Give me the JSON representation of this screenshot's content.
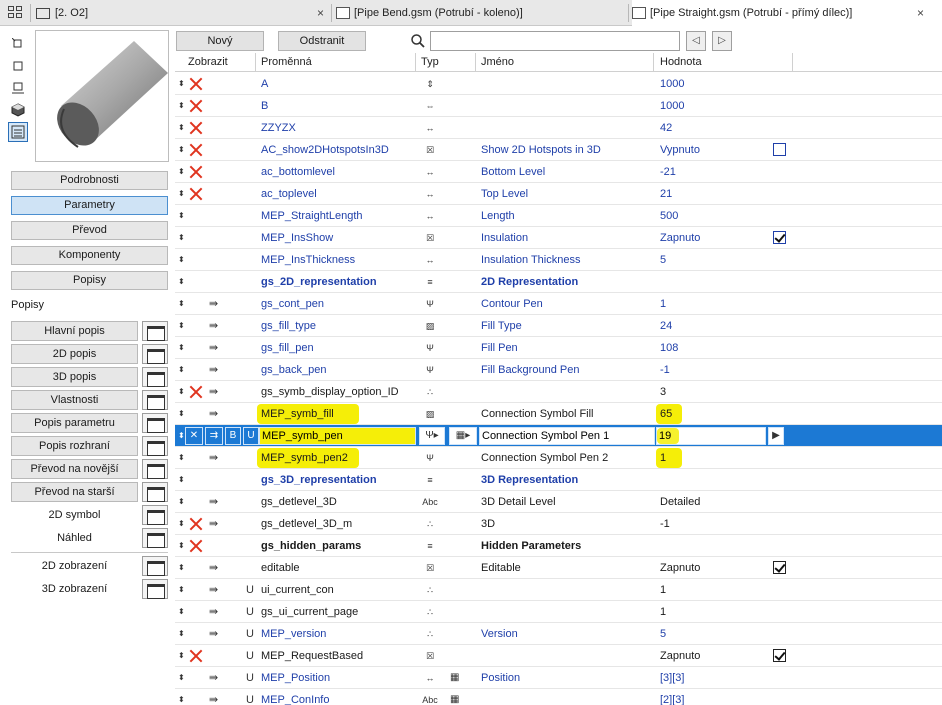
{
  "tabs": [
    {
      "label": "[2. O2]",
      "close": "×"
    },
    {
      "label": "[Pipe Bend.gsm (Potrubí - koleno)]",
      "close": ""
    },
    {
      "label": "[Pipe Straight.gsm (Potrubí - přímý dílec)]",
      "close": "×"
    }
  ],
  "left": {
    "nav_buttons": [
      "Podrobnosti",
      "Parametry",
      "Převod",
      "Komponenty",
      "Popisy"
    ],
    "selected_nav": "Parametry",
    "section_title": "Popisy",
    "popisy_items": [
      "Hlavní popis",
      "2D popis",
      "3D popis",
      "Vlastnosti",
      "Popis parametru",
      "Popis rozhraní",
      "Převod na novější",
      "Převod na starší",
      "2D symbol",
      "Náhled"
    ],
    "view_items": [
      "2D zobrazení",
      "3D zobrazení"
    ]
  },
  "toolbar": {
    "new_label": "Nový",
    "remove_label": "Odstranit",
    "search_value": "",
    "prev": "◁",
    "next": "▷"
  },
  "table": {
    "headers": [
      "Zobrazit",
      "Proměnná",
      "Typ",
      "Jméno",
      "Hodnota"
    ],
    "rows": [
      {
        "var": "A",
        "type_icon": "length-x",
        "name": "",
        "value": "1000",
        "x": true
      },
      {
        "var": "B",
        "type_icon": "length-y",
        "name": "",
        "value": "1000",
        "x": true
      },
      {
        "var": "ZZYZX",
        "type_icon": "length-z",
        "name": "",
        "value": "42",
        "x": true
      },
      {
        "var": "AC_show2DHotspotsIn3D",
        "type_icon": "boolean",
        "name": "Show 2D Hotspots in 3D",
        "value": "Vypnuto",
        "x": true,
        "check": "off"
      },
      {
        "var": "ac_bottomlevel",
        "type_icon": "length",
        "name": "Bottom Level",
        "value": "-21",
        "x": true
      },
      {
        "var": "ac_toplevel",
        "type_icon": "length",
        "name": "Top Level",
        "value": "21",
        "x": true
      },
      {
        "var": "MEP_StraightLength",
        "type_icon": "length",
        "name": "Length",
        "value": "500"
      },
      {
        "var": "MEP_InsShow",
        "type_icon": "boolean",
        "name": "Insulation",
        "value": "Zapnuto",
        "check": "on"
      },
      {
        "var": "MEP_InsThickness",
        "type_icon": "length",
        "name": "Insulation Thickness",
        "value": "5"
      },
      {
        "var": "gs_2D_representation",
        "type_icon": "title",
        "name": "2D Representation",
        "value": "",
        "bold": true
      },
      {
        "var": "gs_cont_pen",
        "type_icon": "pen",
        "name": "Contour Pen",
        "value": "1",
        "indent": true
      },
      {
        "var": "gs_fill_type",
        "type_icon": "fill",
        "name": "Fill Type",
        "value": "24",
        "indent": true
      },
      {
        "var": "gs_fill_pen",
        "type_icon": "pen",
        "name": "Fill Pen",
        "value": "108",
        "indent": true
      },
      {
        "var": "gs_back_pen",
        "type_icon": "pen",
        "name": "Fill Background Pen",
        "value": "-1",
        "indent": true
      },
      {
        "var": "gs_symb_display_option_ID",
        "type_icon": "integer",
        "name": "",
        "value": "3",
        "indent": true,
        "x": true,
        "black": true
      },
      {
        "var": "MEP_symb_fill",
        "type_icon": "fill",
        "name": "Connection Symbol Fill",
        "value": "65",
        "indent": true,
        "black": true
      },
      {
        "var": "MEP_symb_pen",
        "type_icon": "pen",
        "name": "Connection Symbol Pen 1",
        "value": "19",
        "indent": true,
        "black": true,
        "selected": true
      },
      {
        "var": "MEP_symb_pen2",
        "type_icon": "pen",
        "name": "Connection Symbol Pen 2",
        "value": "1",
        "indent": true,
        "black": true
      },
      {
        "var": "gs_3D_representation",
        "type_icon": "title",
        "name": "3D Representation",
        "value": "",
        "bold": true
      },
      {
        "var": "gs_detlevel_3D",
        "type_icon": "text",
        "name": "3D Detail Level",
        "value": "Detailed",
        "indent": true,
        "black": true
      },
      {
        "var": "gs_detlevel_3D_m",
        "type_icon": "integer",
        "name": "3D",
        "value": "-1",
        "indent": true,
        "x": true,
        "black": true
      },
      {
        "var": "gs_hidden_params",
        "type_icon": "title",
        "name": "Hidden Parameters",
        "value": "",
        "bold": true,
        "x": true,
        "black": true
      },
      {
        "var": "editable",
        "type_icon": "boolean",
        "name": "Editable",
        "value": "Zapnuto",
        "indent": true,
        "black": true,
        "check": "on"
      },
      {
        "var": "ui_current_con",
        "type_icon": "integer",
        "name": "",
        "value": "1",
        "indent": true,
        "u": true,
        "black": true
      },
      {
        "var": "gs_ui_current_page",
        "type_icon": "integer",
        "name": "",
        "value": "1",
        "indent": true,
        "u": true,
        "black": true
      },
      {
        "var": "MEP_version",
        "type_icon": "integer",
        "name": "Version",
        "value": "5",
        "indent": true,
        "u": true
      },
      {
        "var": "MEP_RequestBased",
        "type_icon": "boolean",
        "name": "",
        "value": "Zapnuto",
        "u": true,
        "x": true,
        "black": true,
        "check": "on"
      },
      {
        "var": "MEP_Position",
        "type_icon": "length",
        "array": true,
        "name": "Position",
        "value": "[3][3]",
        "indent": true,
        "u": true
      },
      {
        "var": "MEP_ConInfo",
        "type_icon": "text",
        "array": true,
        "name": "",
        "value": "[2][3]",
        "indent": true,
        "u": true
      }
    ]
  },
  "selected_row_buttons": {
    "b": "B",
    "u": "U",
    "more": "▶"
  },
  "type_glyphs": {
    "length-x": "⇕",
    "length-y": "⇔",
    "length-z": "↔",
    "boolean": "☒",
    "length": "↔",
    "title": "≡",
    "pen": "Ψ",
    "fill": "▨",
    "integer": "∴",
    "text": "Abc"
  }
}
